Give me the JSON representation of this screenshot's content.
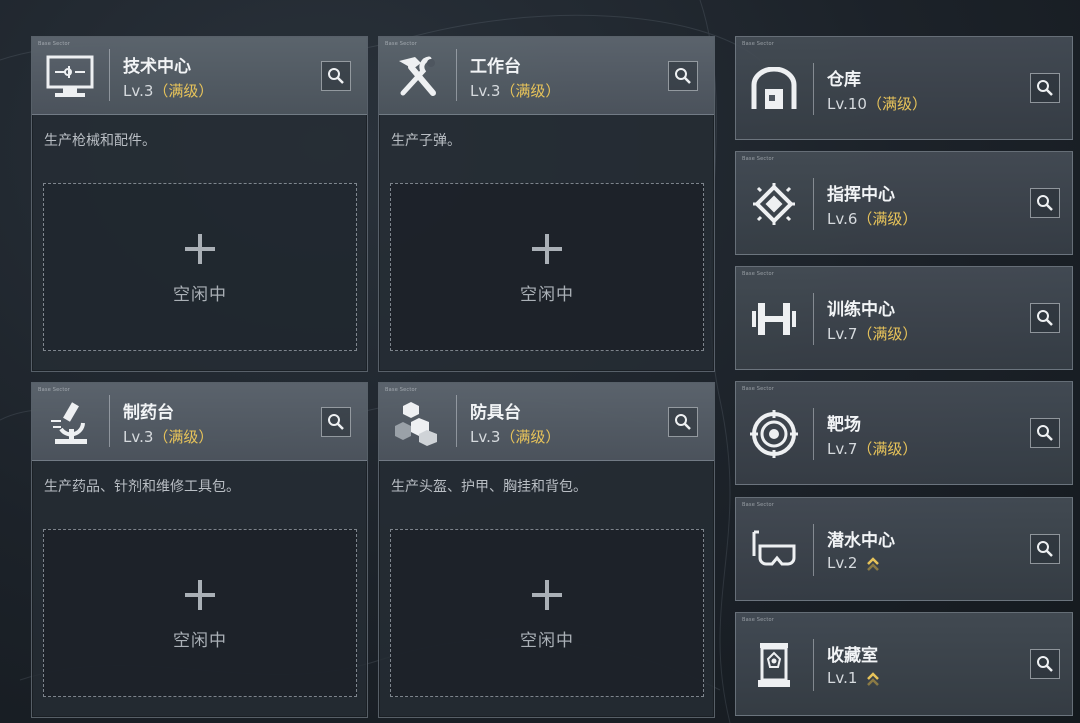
{
  "cards": [
    {
      "tag": "Base Sector",
      "name": "技术中心",
      "level": "Lv.3",
      "level_max": "（满级）",
      "desc": "生产枪械和配件。",
      "slot_label": "空闲中",
      "icon": "computer-icon"
    },
    {
      "tag": "Base Sector",
      "name": "工作台",
      "level": "Lv.3",
      "level_max": "（满级）",
      "desc": "生产子弹。",
      "slot_label": "空闲中",
      "icon": "hammer-wrench-icon"
    },
    {
      "tag": "Base Sector",
      "name": "制药台",
      "level": "Lv.3",
      "level_max": "（满级）",
      "desc": "生产药品、针剂和维修工具包。",
      "slot_label": "空闲中",
      "icon": "microscope-icon"
    },
    {
      "tag": "Base Sector",
      "name": "防具台",
      "level": "Lv.3",
      "level_max": "（满级）",
      "desc": "生产头盔、护甲、胸挂和背包。",
      "slot_label": "空闲中",
      "icon": "cubes-icon"
    }
  ],
  "facilities": [
    {
      "tag": "Base Sector",
      "name": "仓库",
      "level": "Lv.10",
      "level_max": "（满级）",
      "icon": "warehouse-icon",
      "upgradable": false
    },
    {
      "tag": "Base Sector",
      "name": "指挥中心",
      "level": "Lv.6",
      "level_max": "（满级）",
      "icon": "command-chip-icon",
      "upgradable": false
    },
    {
      "tag": "Base Sector",
      "name": "训练中心",
      "level": "Lv.7",
      "level_max": "（满级）",
      "icon": "dumbbell-icon",
      "upgradable": false
    },
    {
      "tag": "Base Sector",
      "name": "靶场",
      "level": "Lv.7",
      "level_max": "（满级）",
      "icon": "target-icon",
      "upgradable": false
    },
    {
      "tag": "Base Sector",
      "name": "潜水中心",
      "level": "Lv.2",
      "level_max": "",
      "icon": "dive-mask-icon",
      "upgradable": true
    },
    {
      "tag": "Base Sector",
      "name": "收藏室",
      "level": "Lv.1",
      "level_max": "",
      "icon": "display-case-icon",
      "upgradable": true
    }
  ],
  "colors": {
    "max_level": "#e7c35a",
    "upgrade_arrow": "#e7c35a",
    "panel": "#262d35"
  }
}
